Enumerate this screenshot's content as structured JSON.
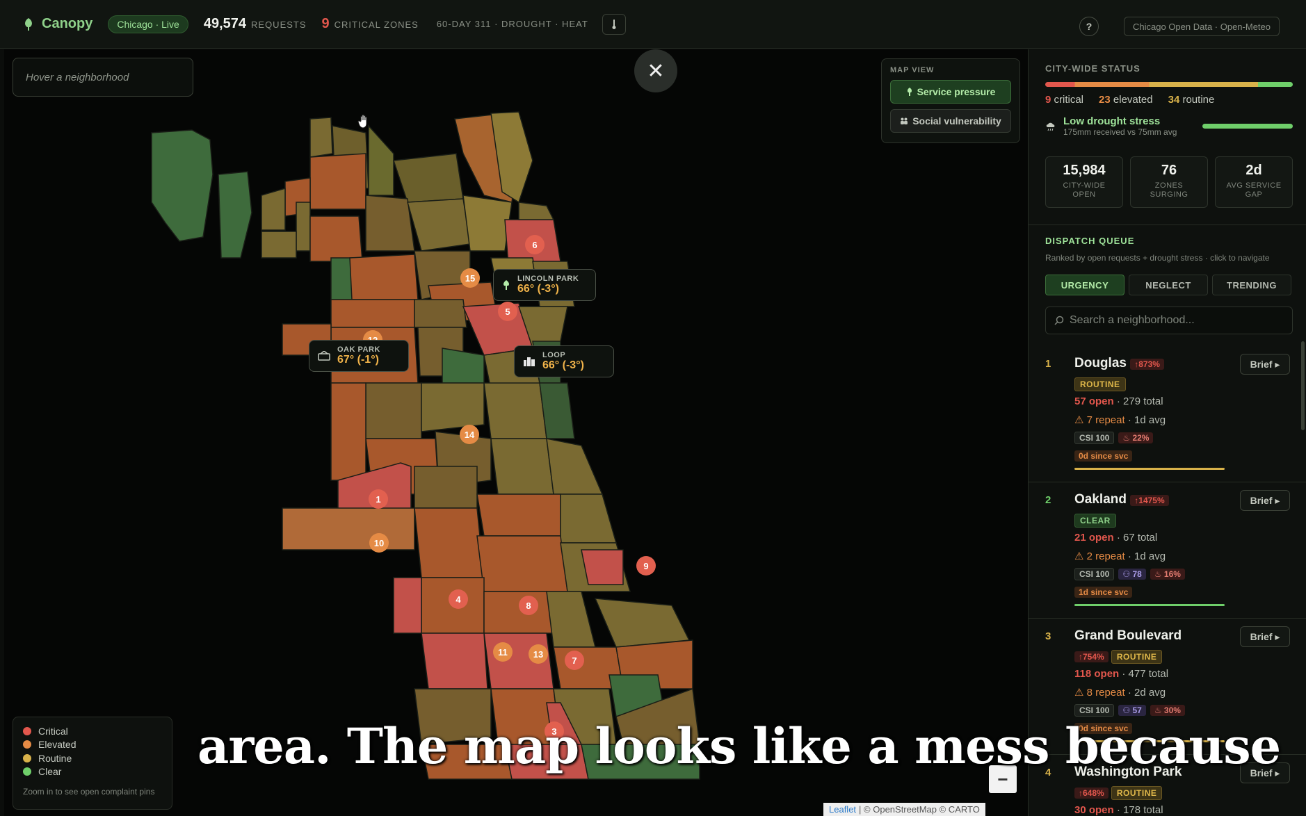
{
  "topbar": {
    "brand": "Canopy",
    "city_pill": "Chicago · Live",
    "requests_value": "49,574",
    "requests_label": "REQUESTS",
    "critical_value": "9",
    "critical_label": "CRITICAL ZONES",
    "context": "60-DAY 311 · DROUGHT · HEAT",
    "help": "?",
    "source": "Chicago Open Data · Open-Meteo"
  },
  "map": {
    "hover_placeholder": "Hover a neighborhood",
    "close": "✕",
    "map_view": {
      "title": "MAP VIEW",
      "options": [
        "Service pressure",
        "Social vulnerability"
      ],
      "active": "Service pressure"
    },
    "pins": [
      {
        "name": "LINCOLN PARK",
        "temp": "66° (-3°)"
      },
      {
        "name": "OAK PARK",
        "temp": "67° (-1°)"
      },
      {
        "name": "LOOP",
        "temp": "66° (-3°)"
      }
    ],
    "badges": [
      "1",
      "3",
      "4",
      "5",
      "6",
      "7",
      "8",
      "9",
      "10",
      "11",
      "12",
      "13",
      "14",
      "15"
    ],
    "legend": {
      "items": [
        {
          "label": "Critical",
          "color": "#e2574d"
        },
        {
          "label": "Elevated",
          "color": "#e58b45"
        },
        {
          "label": "Routine",
          "color": "#d8b24a"
        },
        {
          "label": "Clear",
          "color": "#6fcf6a"
        }
      ],
      "note": "Zoom in to see open complaint pins"
    },
    "zoom_out": "−",
    "attribution_link": "Leaflet",
    "attribution_rest": "| © OpenStreetMap © CARTO"
  },
  "subtitle": "area. The map looks like a mess because",
  "panel": {
    "citywide": {
      "title": "CITY-WIDE STATUS",
      "critical": "9",
      "critical_label": "critical",
      "elevated": "23",
      "elevated_label": "elevated",
      "routine": "34",
      "routine_label": "routine",
      "drought_title": "Low drought stress",
      "drought_sub": "175mm received vs 75mm avg"
    },
    "cards": [
      {
        "value": "15,984",
        "label_1": "CITY-WIDE",
        "label_2": "OPEN"
      },
      {
        "value": "76",
        "label_1": "ZONES",
        "label_2": "SURGING"
      },
      {
        "value": "2d",
        "label_1": "AVG SERVICE",
        "label_2": "GAP"
      }
    ],
    "queue": {
      "title": "DISPATCH QUEUE",
      "subtitle": "Ranked by open requests + drought stress · click to navigate",
      "tabs": [
        "URGENCY",
        "NEGLECT",
        "TRENDING"
      ],
      "active_tab": "URGENCY",
      "search_placeholder": "Search a neighborhood...",
      "brief_label": "Brief ▸",
      "items": [
        {
          "rank": "1",
          "name": "Douglas",
          "trend": "↑873%",
          "status": "ROUTINE",
          "open": "57 open",
          "total": "279 total",
          "repeat": "⚠ 7 repeat",
          "avg": "1d avg",
          "csi": "CSI 100",
          "vuln": "",
          "heat": "22%",
          "since": "0d since svc"
        },
        {
          "rank": "2",
          "name": "Oakland",
          "trend": "↑1475%",
          "status": "CLEAR",
          "open": "21 open",
          "total": "67 total",
          "repeat": "⚠ 2 repeat",
          "avg": "1d avg",
          "csi": "CSI 100",
          "vuln": "78",
          "heat": "16%",
          "since": "1d since svc"
        },
        {
          "rank": "3",
          "name": "Grand Boulevard",
          "trend": "↑754%",
          "status": "ROUTINE",
          "open": "118 open",
          "total": "477 total",
          "repeat": "⚠ 8 repeat",
          "avg": "2d avg",
          "csi": "CSI 100",
          "vuln": "57",
          "heat": "30%",
          "since": "0d since svc"
        },
        {
          "rank": "4",
          "name": "Washington Park",
          "trend": "↑648%",
          "status": "ROUTINE",
          "open": "30 open",
          "total": "178 total"
        }
      ]
    }
  }
}
